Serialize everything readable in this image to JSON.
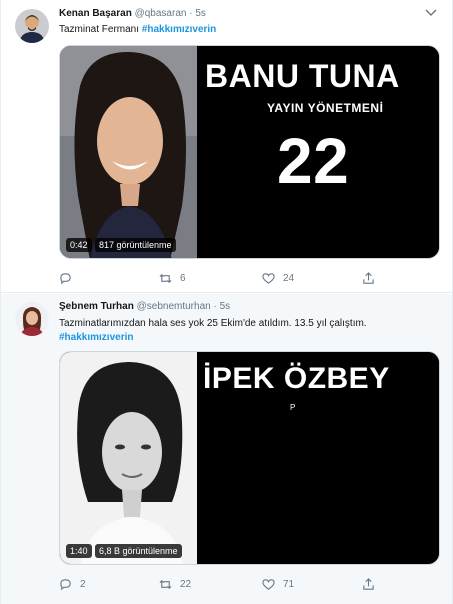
{
  "tweets": [
    {
      "name": "Kenan Başaran",
      "handle": "@qbasaran",
      "dot": "·",
      "time": "5s",
      "text": "Tazminat Fermanı",
      "hashtag": "#hakkımızıverin",
      "video": {
        "title": "BANU TUNA",
        "subtitle": "YAYIN YÖNETMENİ",
        "number": "22",
        "duration": "0:42",
        "views": "817 görüntülenme"
      },
      "replies": "",
      "retweets": "6",
      "likes": "24"
    },
    {
      "name": "Şebnem Turhan",
      "handle": "@sebnemturhan",
      "dot": "·",
      "time": "5s",
      "text": "Tazminatlarımızdan hala ses yok 25 Ekim'de atıldım. 13.5 yıl çalıştım.",
      "hashtag": "#hakkımızıverin",
      "video": {
        "title": "İPEK ÖZBEY",
        "small": "P",
        "duration": "1:40",
        "views": "6,8 B görüntülenme"
      },
      "replies": "2",
      "retweets": "22",
      "likes": "71"
    }
  ],
  "colors": {
    "link": "#1b95e0",
    "muted": "#657786",
    "border": "#e6ecf0"
  },
  "icons": [
    "reply-icon",
    "retweet-icon",
    "like-icon",
    "share-icon",
    "caret-down-icon"
  ]
}
